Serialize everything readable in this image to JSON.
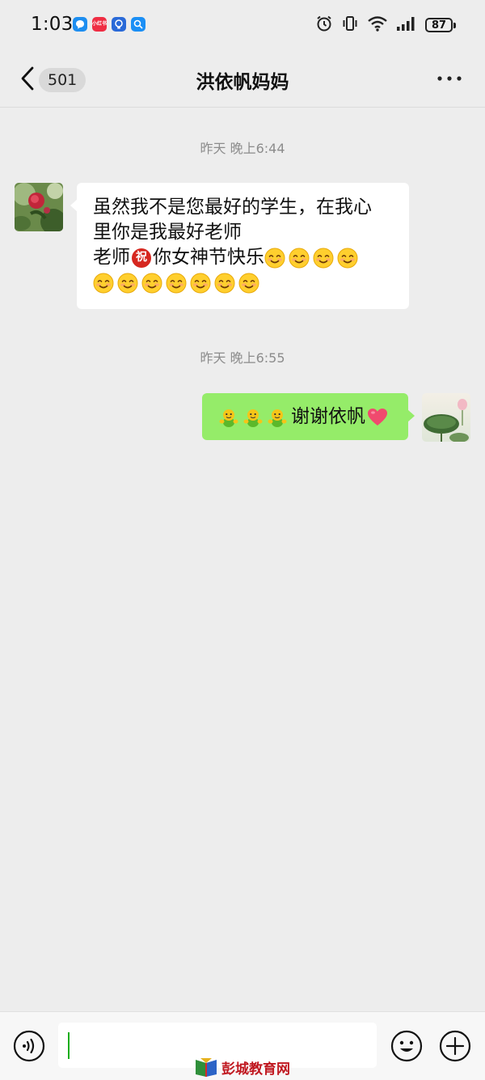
{
  "status_bar": {
    "time": "1:03",
    "app_icons": [
      {
        "name": "chat-bubble-icon",
        "color": "#1e8ef0",
        "glyph": "○"
      },
      {
        "name": "xiaohongshu-icon",
        "color": "#ef2d43",
        "glyph": "小红书"
      },
      {
        "name": "lightbulb-icon",
        "color": "#2a6ad8",
        "glyph": "◎"
      },
      {
        "name": "search-app-icon",
        "color": "#1b8ff5",
        "glyph": "Q"
      }
    ],
    "battery": "87"
  },
  "nav": {
    "unread_count": "501",
    "title": "洪依帆妈妈"
  },
  "messages": [
    {
      "time": "昨天 晚上6:44",
      "direction": "incoming",
      "lines": [
        "虽然我不是您最好的学生，在我心",
        "里你是我最好老师"
      ],
      "line3_prefix": "老师",
      "line3_blessing": "祝",
      "line3_suffix": "你女神节快乐"
    },
    {
      "time": "昨天 晚上6:55",
      "direction": "outgoing",
      "text": "谢谢依帆"
    }
  ],
  "input": {
    "placeholder": ""
  },
  "watermark": "彭城教育网",
  "colors": {
    "background": "#ededed",
    "incoming_bubble": "#ffffff",
    "outgoing_bubble": "#95ec69"
  }
}
